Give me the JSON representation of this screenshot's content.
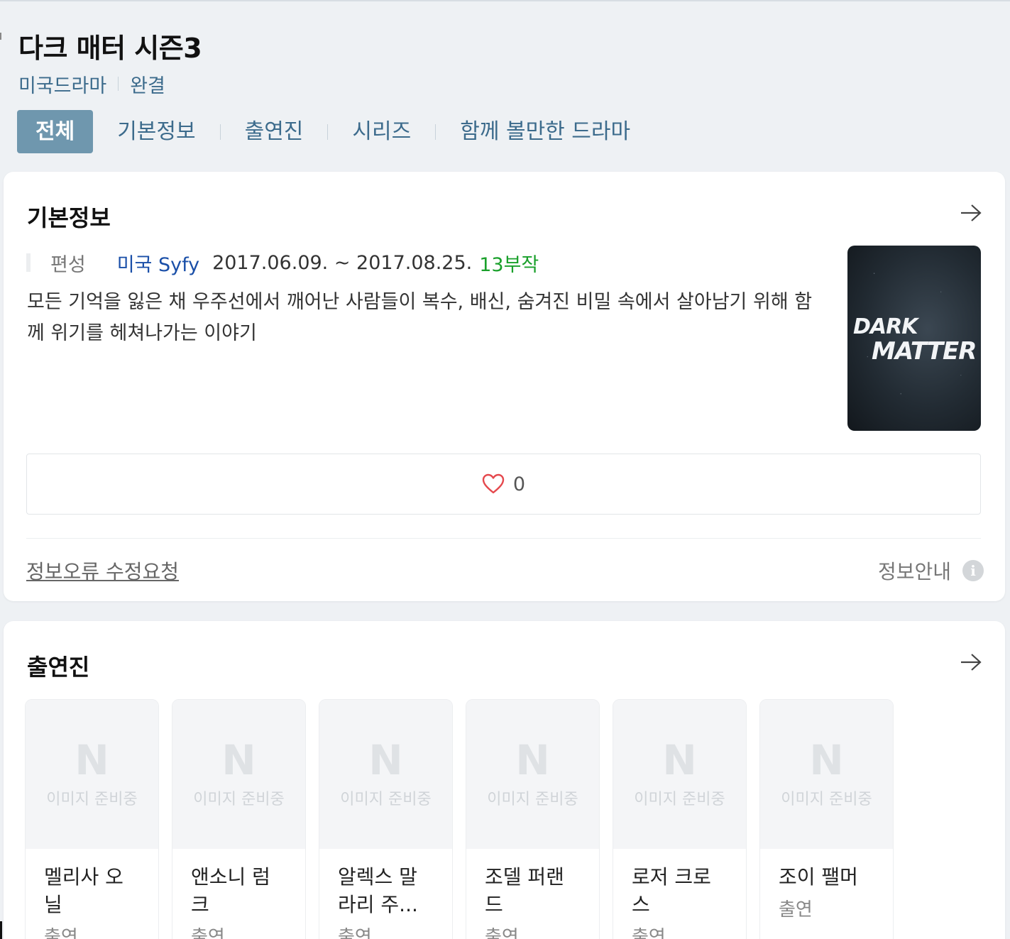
{
  "header": {
    "title": "다크 매터 시즌3",
    "category": "미국드라마",
    "status": "완결"
  },
  "tabs": [
    {
      "label": "전체",
      "active": true
    },
    {
      "label": "기본정보",
      "active": false
    },
    {
      "label": "출연진",
      "active": false
    },
    {
      "label": "시리즈",
      "active": false
    },
    {
      "label": "함께 볼만한 드라마",
      "active": false
    }
  ],
  "basic_info": {
    "section_title": "기본정보",
    "air_label": "편성",
    "network": "미국 Syfy",
    "dates": "2017.06.09. ~ 2017.08.25.",
    "episodes": "13부작",
    "summary": "모든 기억을 잃은 채 우주선에서 깨어난 사람들이 복수, 배신, 숨겨진 비밀 속에서 살아남기 위해 함께 위기를 헤쳐나가는 이야기",
    "poster_logo_line1": "DARK",
    "poster_logo_line2": "MATTER",
    "like_count": "0",
    "report_link": "정보오류 수정요청",
    "info_guide": "정보안내",
    "info_icon_glyph": "i"
  },
  "cast": {
    "section_title": "출연진",
    "placeholder_letter": "N",
    "placeholder_text": "이미지 준비중",
    "members": [
      {
        "name": "멜리사 오닐",
        "role": "출연"
      },
      {
        "name": "앤소니 럼크",
        "role": "출연"
      },
      {
        "name": "알렉스 말라리 주...",
        "role": "출연"
      },
      {
        "name": "조델 퍼랜드",
        "role": "출연"
      },
      {
        "name": "로저 크로스",
        "role": "출연"
      },
      {
        "name": "조이 팰머",
        "role": "출연"
      }
    ]
  },
  "colors": {
    "accent_tab": "#6f97ae",
    "link_blue": "#3c6b8c",
    "network_blue": "#1a4fa8",
    "episodes_green": "#1aa02b",
    "heart_red": "#e5484d"
  },
  "icons": {
    "arrow": "arrow-right-icon",
    "heart": "heart-icon",
    "info": "info-icon"
  }
}
